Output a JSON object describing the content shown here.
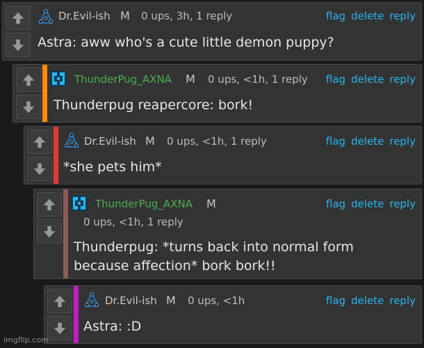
{
  "comments": [
    {
      "username": "Dr.Evil-ish",
      "mod": "M",
      "meta": "0 ups, 3h, 1 reply",
      "text": [
        "Astra: aww who's a cute little demon puppy?"
      ],
      "user_color": "#c9c9c9",
      "accent_color": null
    },
    {
      "username": "ThunderPug_AXNA",
      "mod": "M",
      "meta": "0 ups, <1h, 1 reply",
      "text": [
        "Thunderpug reapercore: bork!"
      ],
      "user_color": "#4caf50",
      "accent_color": "#ff8c00"
    },
    {
      "username": "Dr.Evil-ish",
      "mod": "M",
      "meta": "0 ups, <1h, 1 reply",
      "text": [
        "*she pets him*"
      ],
      "user_color": "#c9c9c9",
      "accent_color": "#e53935"
    },
    {
      "username": "ThunderPug_AXNA",
      "mod": "M",
      "meta": "0 ups, <1h, 1 reply",
      "text": [
        "Thunderpug: *turns back into normal form",
        "because affection* bork bork!!"
      ],
      "user_color": "#4caf50",
      "accent_color": "#8d5a5a"
    },
    {
      "username": "Dr.Evil-ish",
      "mod": "M",
      "meta": "0 ups, <1h",
      "text": [
        "Astra: :D"
      ],
      "user_color": "#c9c9c9",
      "accent_color": "#c21bc2"
    }
  ],
  "actions": {
    "flag": "flag",
    "delete": "delete",
    "reply": "reply"
  },
  "icons": {
    "upvote": "up-arrow-icon",
    "downvote": "down-arrow-icon"
  },
  "watermark": "imgflip.com"
}
